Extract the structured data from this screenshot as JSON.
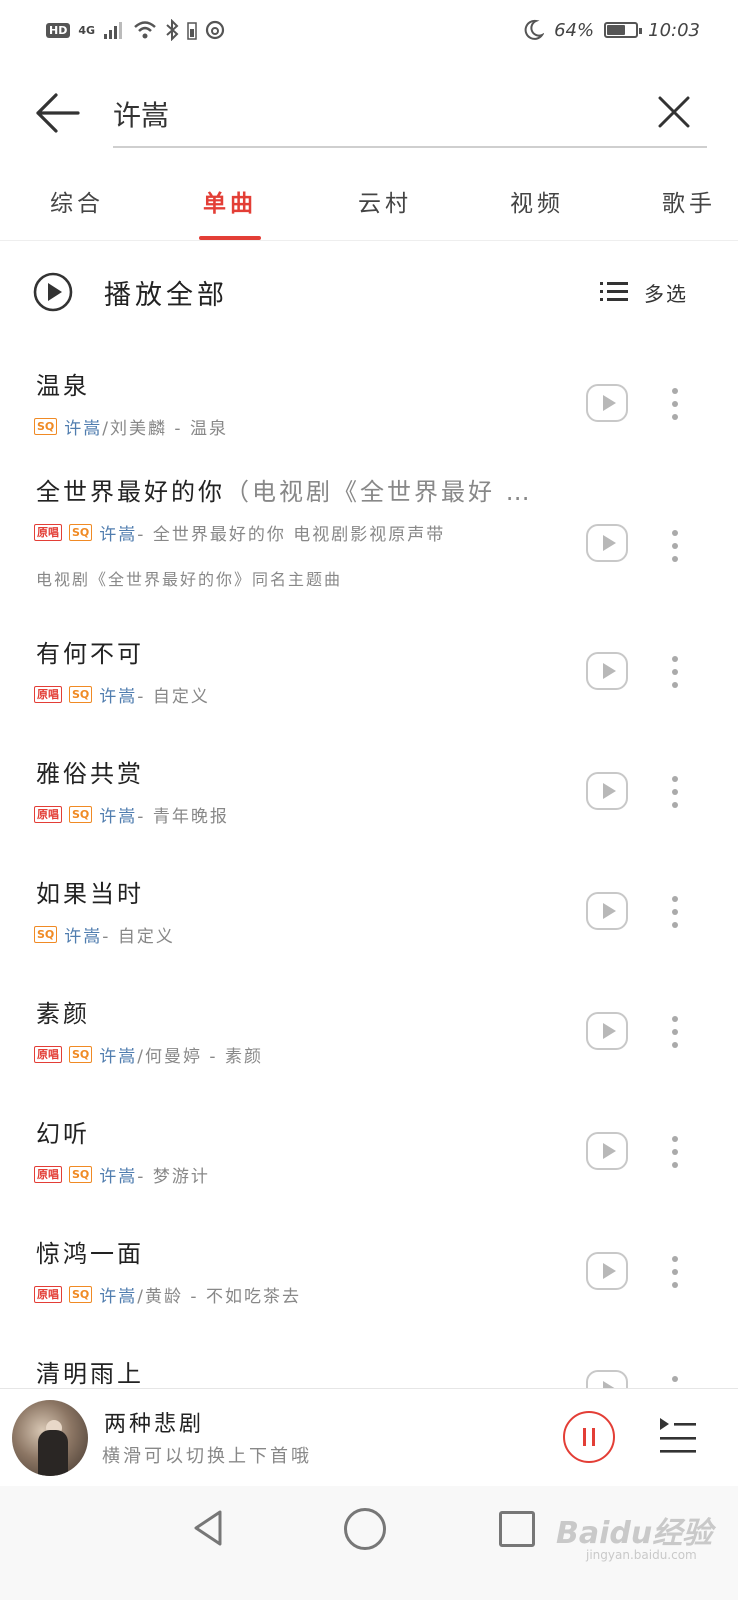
{
  "status_bar": {
    "hd": "HD",
    "network": "4G",
    "battery_percent": "64%",
    "battery_level": 0.64,
    "time": "10:03"
  },
  "search": {
    "query": "许嵩"
  },
  "tabs": [
    {
      "label": "综合",
      "active": false
    },
    {
      "label": "单曲",
      "active": true
    },
    {
      "label": "云村",
      "active": false
    },
    {
      "label": "视频",
      "active": false
    },
    {
      "label": "歌手",
      "active": false
    }
  ],
  "toolbar": {
    "play_all_label": "播放全部",
    "multi_select_label": "多选"
  },
  "songs": [
    {
      "title": "温泉",
      "alias": "",
      "original": false,
      "sq": true,
      "artist": "许嵩",
      "rest": "/刘美麟 - 温泉",
      "desc": ""
    },
    {
      "title": "全世界最好的你",
      "alias": "（电视剧《全世界最好 …",
      "original": true,
      "sq": true,
      "artist": "许嵩",
      "rest": " - 全世界最好的你 电视剧影视原声带",
      "desc": "电视剧《全世界最好的你》同名主题曲"
    },
    {
      "title": "有何不可",
      "alias": "",
      "original": true,
      "sq": true,
      "artist": "许嵩",
      "rest": " - 自定义",
      "desc": ""
    },
    {
      "title": "雅俗共赏",
      "alias": "",
      "original": true,
      "sq": true,
      "artist": "许嵩",
      "rest": " - 青年晚报",
      "desc": ""
    },
    {
      "title": "如果当时",
      "alias": "",
      "original": false,
      "sq": true,
      "artist": "许嵩",
      "rest": " - 自定义",
      "desc": ""
    },
    {
      "title": "素颜",
      "alias": "",
      "original": true,
      "sq": true,
      "artist": "许嵩",
      "rest": "/何曼婷 - 素颜",
      "desc": ""
    },
    {
      "title": "幻听",
      "alias": "",
      "original": true,
      "sq": true,
      "artist": "许嵩",
      "rest": " - 梦游计",
      "desc": ""
    },
    {
      "title": "惊鸿一面",
      "alias": "",
      "original": true,
      "sq": true,
      "artist": "许嵩",
      "rest": "/黄龄 - 不如吃茶去",
      "desc": ""
    },
    {
      "title": "清明雨上",
      "alias": "",
      "original": false,
      "sq": false,
      "artist": "",
      "rest": "",
      "desc": ""
    }
  ],
  "tag_labels": {
    "original": "原唱",
    "sq": "SQ"
  },
  "player": {
    "title": "两种悲剧",
    "hint": "横滑可以切换上下首哦"
  },
  "watermark": {
    "brand": "Baidu经验",
    "url": "jingyan.baidu.com"
  },
  "colors": {
    "accent": "#e33e36",
    "artist_link": "#507daf",
    "sq_tag": "#f08a24"
  },
  "icons": [
    "back-arrow-icon",
    "close-icon",
    "play-circle-icon",
    "list-icon",
    "mv-play-icon",
    "more-vertical-icon",
    "pause-icon",
    "playlist-icon",
    "nav-back-icon",
    "nav-home-icon",
    "nav-recent-icon"
  ]
}
